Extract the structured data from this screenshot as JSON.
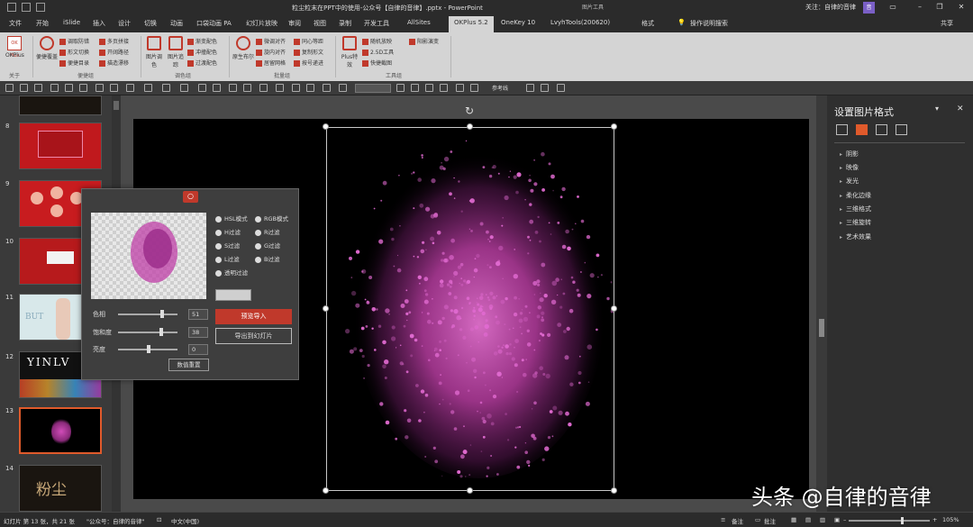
{
  "titlebar": {
    "title": "粒尘粒末在PPT中的使用-公众号【自律的音律】.pptx - PowerPoint",
    "tools_label": "图片工具",
    "follow": "关注：自律的音律",
    "badge": "音"
  },
  "tabs": [
    {
      "label": "文件"
    },
    {
      "label": "开始"
    },
    {
      "label": "iSlide"
    },
    {
      "label": "插入"
    },
    {
      "label": "设计"
    },
    {
      "label": "切换"
    },
    {
      "label": "动画"
    },
    {
      "label": "口袋动画 PA"
    },
    {
      "label": "幻灯片放映"
    },
    {
      "label": "审阅"
    },
    {
      "label": "视图"
    },
    {
      "label": "录制"
    },
    {
      "label": "开发工具"
    },
    {
      "label": "AllSites"
    },
    {
      "label": "OKPlus 5.2"
    },
    {
      "label": "OneKey 10"
    },
    {
      "label": "LvyhTools(200620)"
    },
    {
      "label": "格式"
    }
  ],
  "tab_search": "操作说明搜索",
  "share": "共享",
  "ribbon": {
    "okplus_logo": "OK Plus",
    "okplus_label": "OKPlus",
    "about_label": "关于",
    "big": [
      "便捷覆盖",
      "图片调色",
      "图片追踪",
      "原生布尔",
      "Plus特效"
    ],
    "small_col1": [
      "调取防错",
      "形文切换",
      "便捷目录"
    ],
    "small_col2": [
      "多页拼接",
      "开阔路径",
      "描造漂移"
    ],
    "small_col3": [
      "渐变配色",
      "冲撞配色",
      "过渡配色"
    ],
    "small_col4": [
      "微调对齐",
      "旋内对齐",
      "居留网格"
    ],
    "small_col5": [
      "同心等距",
      "复制形文",
      "按号递进"
    ],
    "small_col6": [
      "随机放映",
      "2.5D工具",
      "快捷截图"
    ],
    "small_col7": [
      "阳影演变"
    ],
    "groups": [
      "便捷组",
      "调色组",
      "批量组",
      "工具组"
    ]
  },
  "toolbar2": {
    "ref_label": "参考线"
  },
  "thumbnails": [
    {
      "num": "8",
      "bg": "#c0191d"
    },
    {
      "num": "9",
      "bg": "#c81c1f"
    },
    {
      "num": "10",
      "bg": "#b71a1c"
    },
    {
      "num": "11",
      "bg": "#d8e8ea"
    },
    {
      "num": "12",
      "bg": "#111111"
    },
    {
      "num": "13",
      "bg": "#000000",
      "selected": true
    },
    {
      "num": "14",
      "bg": "#1a1510"
    }
  ],
  "thumb_texts": {
    "t11": "BUT",
    "t12": "YINLV",
    "t14": "粉尘"
  },
  "pane": {
    "title": "设置图片格式",
    "items": [
      "阴影",
      "映像",
      "发光",
      "柔化边缘",
      "三维格式",
      "三维旋转",
      "艺术效果"
    ]
  },
  "dialog": {
    "radios": [
      "HSL模式",
      "RGB模式",
      "H过滤",
      "R过滤",
      "S过滤",
      "G过滤",
      "L过滤",
      "B过滤",
      "透明过滤"
    ],
    "sliders": [
      {
        "label": "色相",
        "value": "51",
        "level": 0.74
      },
      {
        "label": "饱和度",
        "value": "38",
        "level": 0.72
      },
      {
        "label": "亮度",
        "value": "0",
        "level": 0.52
      }
    ],
    "primary_button": "预览导入",
    "secondary_button": "导出到幻灯片",
    "reset_button": "数值重置",
    "particle_color": "#c040a8"
  },
  "status": {
    "slide_info": "幻灯片 第 13 张，共 21 张",
    "theme": "\"公众号：自律的音律\"",
    "language": "中文(中国)",
    "notes": "备注",
    "comments": "批注",
    "zoom": "105%"
  },
  "colors": {
    "accent": "#c0392b",
    "selection_orange": "#e05a2b",
    "particle_pink": "#d04cb8"
  },
  "watermark": "头条 @自律的音律"
}
